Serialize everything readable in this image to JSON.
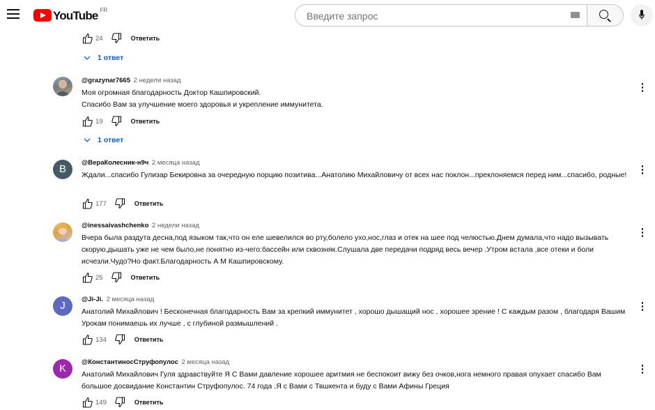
{
  "header": {
    "logo_text": "YouTube",
    "region": "FR",
    "search_placeholder": "Введите запрос"
  },
  "top_partial": {
    "like_count": "24",
    "reply_label": "Ответить",
    "replies_label": "1 ответ"
  },
  "comments": [
    {
      "author": "@grazynar7665",
      "timestamp": "2 недели назад",
      "text": "Моя огромная благодарность Доктор Кашпировский.\nСпасибо Вам за улучшение моего здоровья и укрепление иммунитета.",
      "like_count": "19",
      "reply_label": "Ответить",
      "replies_label": "1 ответ",
      "avatar": {
        "type": "photo",
        "colors": [
          "#7f8c8d",
          "#c0a080"
        ]
      }
    },
    {
      "author": "@ВераКолесник-н9ч",
      "timestamp": "2 месяца назад",
      "text": "Ждали...спасибо Гулизар Бекировна за очередную порцию позитива...Анатолию Михайловичу от всех нас поклон...преклоняемся перед ним...спасибо, родные!",
      "like_count": "177",
      "reply_label": "Ответить",
      "avatar": {
        "type": "letter",
        "letter": "В",
        "color": "#455a64"
      }
    },
    {
      "author": "@inessaivashchenko",
      "timestamp": "2 недели назад",
      "text": "Вчера была раздута десна,под языком так,что он еле шевелился во рту,болело ухо,нос,глаз и отек на шее под челюстью.Днем думала,что надо вызывать скорую,дышать уже не чем было,не понятно из-чего:бассейн или сквозняк.Слушала две передачи подряд весь вечер .Утром встала ,все отеки и боли  исчезли.Чудо?Но факт.Благодарность А М Кашпировскому.",
      "like_count": "25",
      "reply_label": "Ответить",
      "avatar": {
        "type": "photo",
        "colors": [
          "#e8b04a",
          "#c9c2d6"
        ]
      }
    },
    {
      "author": "@Ji-Ji.",
      "timestamp": "2 месяца назад",
      "text": "Анатолий Михайлович ! Бесконечная благодарность Вам за крепкий иммунитет , хорошо дышащий нос , хорошее зрение !  С каждым разом , благодаря Вашим Урокам понимаешь их лучше , с глубиной размышлений .",
      "like_count": "134",
      "reply_label": "Ответить",
      "avatar": {
        "type": "letter",
        "letter": "J",
        "color": "#5c6bc0"
      }
    },
    {
      "author": "@КонстантиносСтруфопулос",
      "timestamp": "2 месяца назад",
      "text": "Анатолий Михайлович Гуля здравствуйте Я С Вами давление хорошее аритмия не беспокоит вижу без очков,нога немного правая опухает спасибо Вам большое досвидание Константин Струфопулос.  74 года .Я с Вами с Твшкента и буду с Вами  Афины Греция",
      "like_count": "149",
      "reply_label": "Ответить",
      "avatar": {
        "type": "letter",
        "letter": "K",
        "color": "#9c27b0"
      }
    }
  ]
}
